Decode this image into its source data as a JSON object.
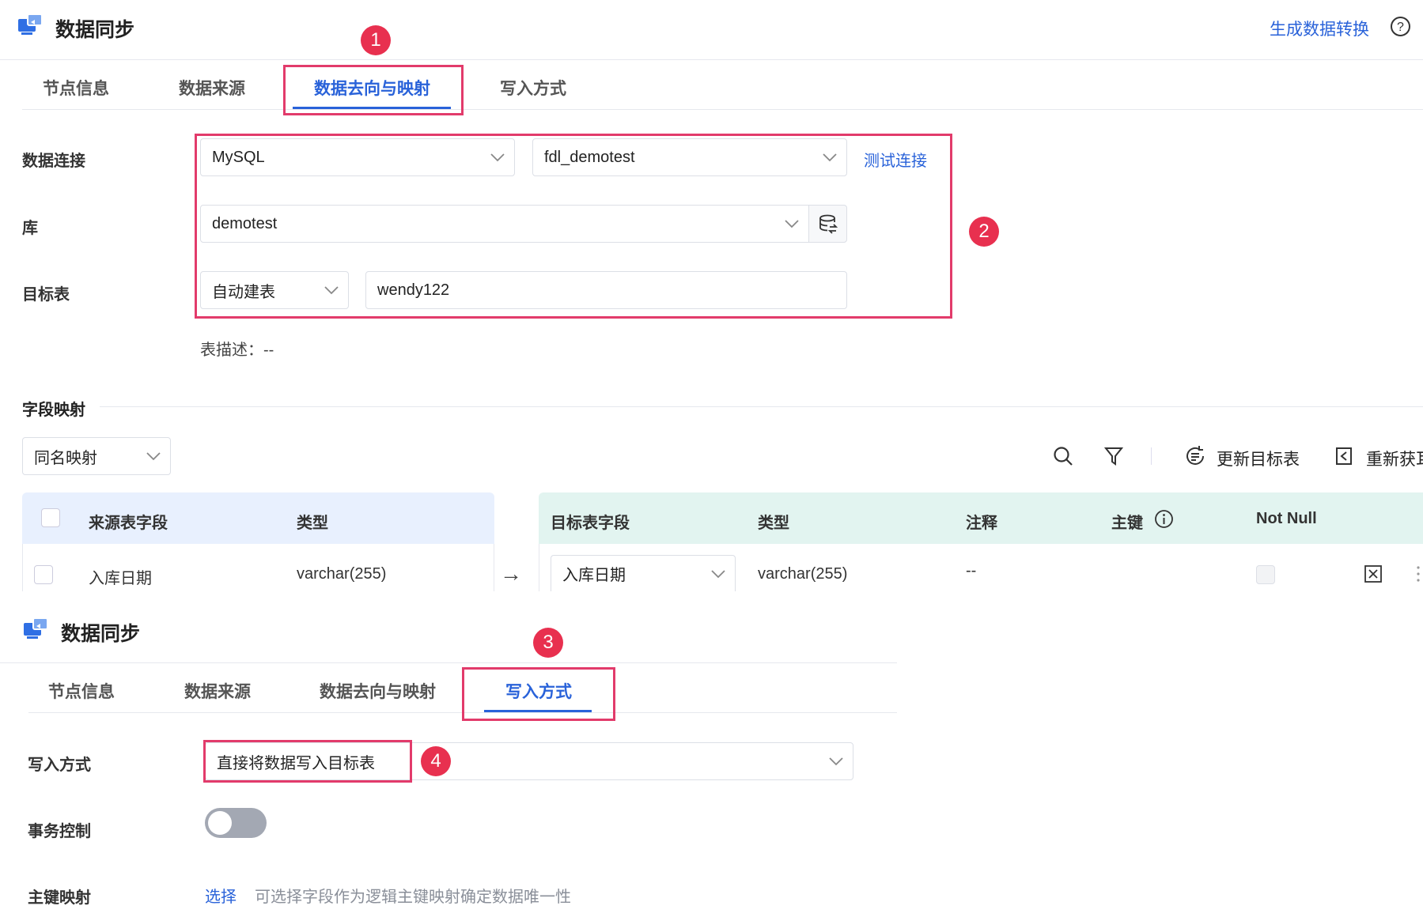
{
  "panel1": {
    "title": "数据同步",
    "header_link": "生成数据转换",
    "tabs": [
      "节点信息",
      "数据来源",
      "数据去向与映射",
      "写入方式"
    ],
    "active_tab": 2,
    "badges": [
      "1",
      "2"
    ],
    "form": {
      "connection_label": "数据连接",
      "connection_type": "MySQL",
      "connection_name": "fdl_demotest",
      "test_link": "测试连接",
      "db_label": "库",
      "db_value": "demotest",
      "target_label": "目标表",
      "target_mode": "自动建表",
      "target_name": "wendy122",
      "table_desc": "表描述：--"
    },
    "mapping": {
      "section_title": "字段映射",
      "mapping_mode": "同名映射",
      "update_target": "更新目标表",
      "refetch": "重新获耳",
      "source_headers": [
        "来源表字段",
        "类型"
      ],
      "target_headers": [
        "目标表字段",
        "类型",
        "注释",
        "主键",
        "Not Null"
      ],
      "row": {
        "source_field": "入库日期",
        "source_type": "varchar(255)",
        "arrow": "→",
        "target_field": "入库日期",
        "target_type": "varchar(255)",
        "comment": "--"
      }
    }
  },
  "panel2": {
    "title": "数据同步",
    "tabs": [
      "节点信息",
      "数据来源",
      "数据去向与映射",
      "写入方式"
    ],
    "active_tab": 3,
    "badges": [
      "3",
      "4"
    ],
    "write_label": "写入方式",
    "write_value": "直接将数据写入目标表",
    "tx_label": "事务控制",
    "tx_enabled": false,
    "pk_label": "主键映射",
    "pk_link": "选择",
    "pk_hint": "可选择字段作为逻辑主键映射确定数据唯一性"
  },
  "colors": {
    "accent": "#2962d9",
    "highlight": "#e23b6b",
    "badge": "#e8304f"
  }
}
